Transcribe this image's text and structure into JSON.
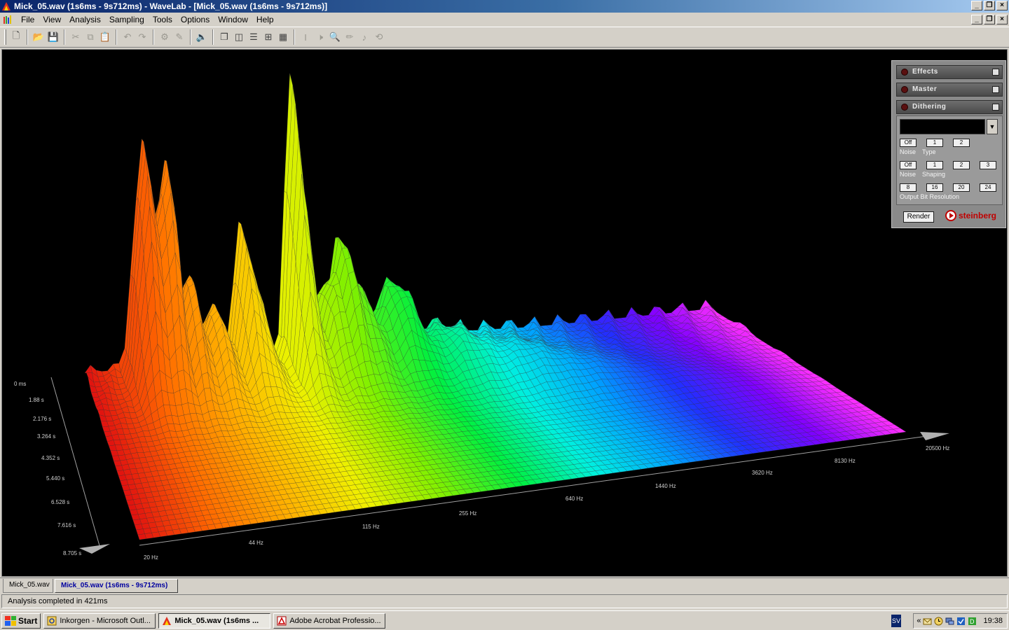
{
  "window": {
    "title": "Mick_05.wav (1s6ms - 9s712ms) - WaveLab - [Mick_05.wav (1s6ms - 9s712ms)]"
  },
  "menu": {
    "items": [
      "File",
      "View",
      "Analysis",
      "Sampling",
      "Tools",
      "Options",
      "Window",
      "Help"
    ]
  },
  "toolbar": {
    "buttons": [
      "new-document",
      "open",
      "save",
      "cut",
      "copy",
      "paste",
      "undo",
      "redo",
      "audio-to-midi",
      "pencil",
      "speaker",
      "cascade",
      "tile",
      "horizontal-split",
      "montage",
      "mixer",
      "cursor",
      "listen",
      "zoom",
      "draw",
      "play",
      "loop"
    ]
  },
  "spectrum": {
    "time_labels": [
      "0 ms",
      "1.88 s",
      "2.176 s",
      "3.264 s",
      "4.352 s",
      "5.440 s",
      "6.528 s",
      "7.616 s",
      "8.705 s"
    ],
    "freq_labels": [
      "20 Hz",
      "44 Hz",
      "115 Hz",
      "255 Hz",
      "640 Hz",
      "1440 Hz",
      "3620 Hz",
      "8130 Hz",
      "20500 Hz"
    ]
  },
  "master_panel": {
    "sections": [
      "Effects",
      "Master",
      "Dithering"
    ],
    "noise_type_label_1": "Noise",
    "noise_type_label_2": "Type",
    "noise_type_buttons": [
      "Off",
      "1",
      "2"
    ],
    "noise_shaping_label_1": "Noise",
    "noise_shaping_label_2": "Shaping",
    "noise_shaping_buttons": [
      "Off",
      "1",
      "2",
      "3"
    ],
    "bit_resolution_label": "Output Bit Resolution",
    "bit_buttons": [
      "8",
      "16",
      "20",
      "24"
    ],
    "render_label": "Render",
    "brand": "steinberg"
  },
  "document_tabs": [
    "Mick_05.wav",
    "Mick_05.wav (1s6ms - 9s712ms)"
  ],
  "status": {
    "text": "Analysis completed in 421ms"
  },
  "taskbar": {
    "start_label": "Start",
    "tasks": [
      "Inkorgen - Microsoft Outl...",
      "Mick_05.wav (1s6ms ...",
      "Adobe Acrobat Professio..."
    ],
    "language": "SV",
    "clock": "19:38"
  }
}
